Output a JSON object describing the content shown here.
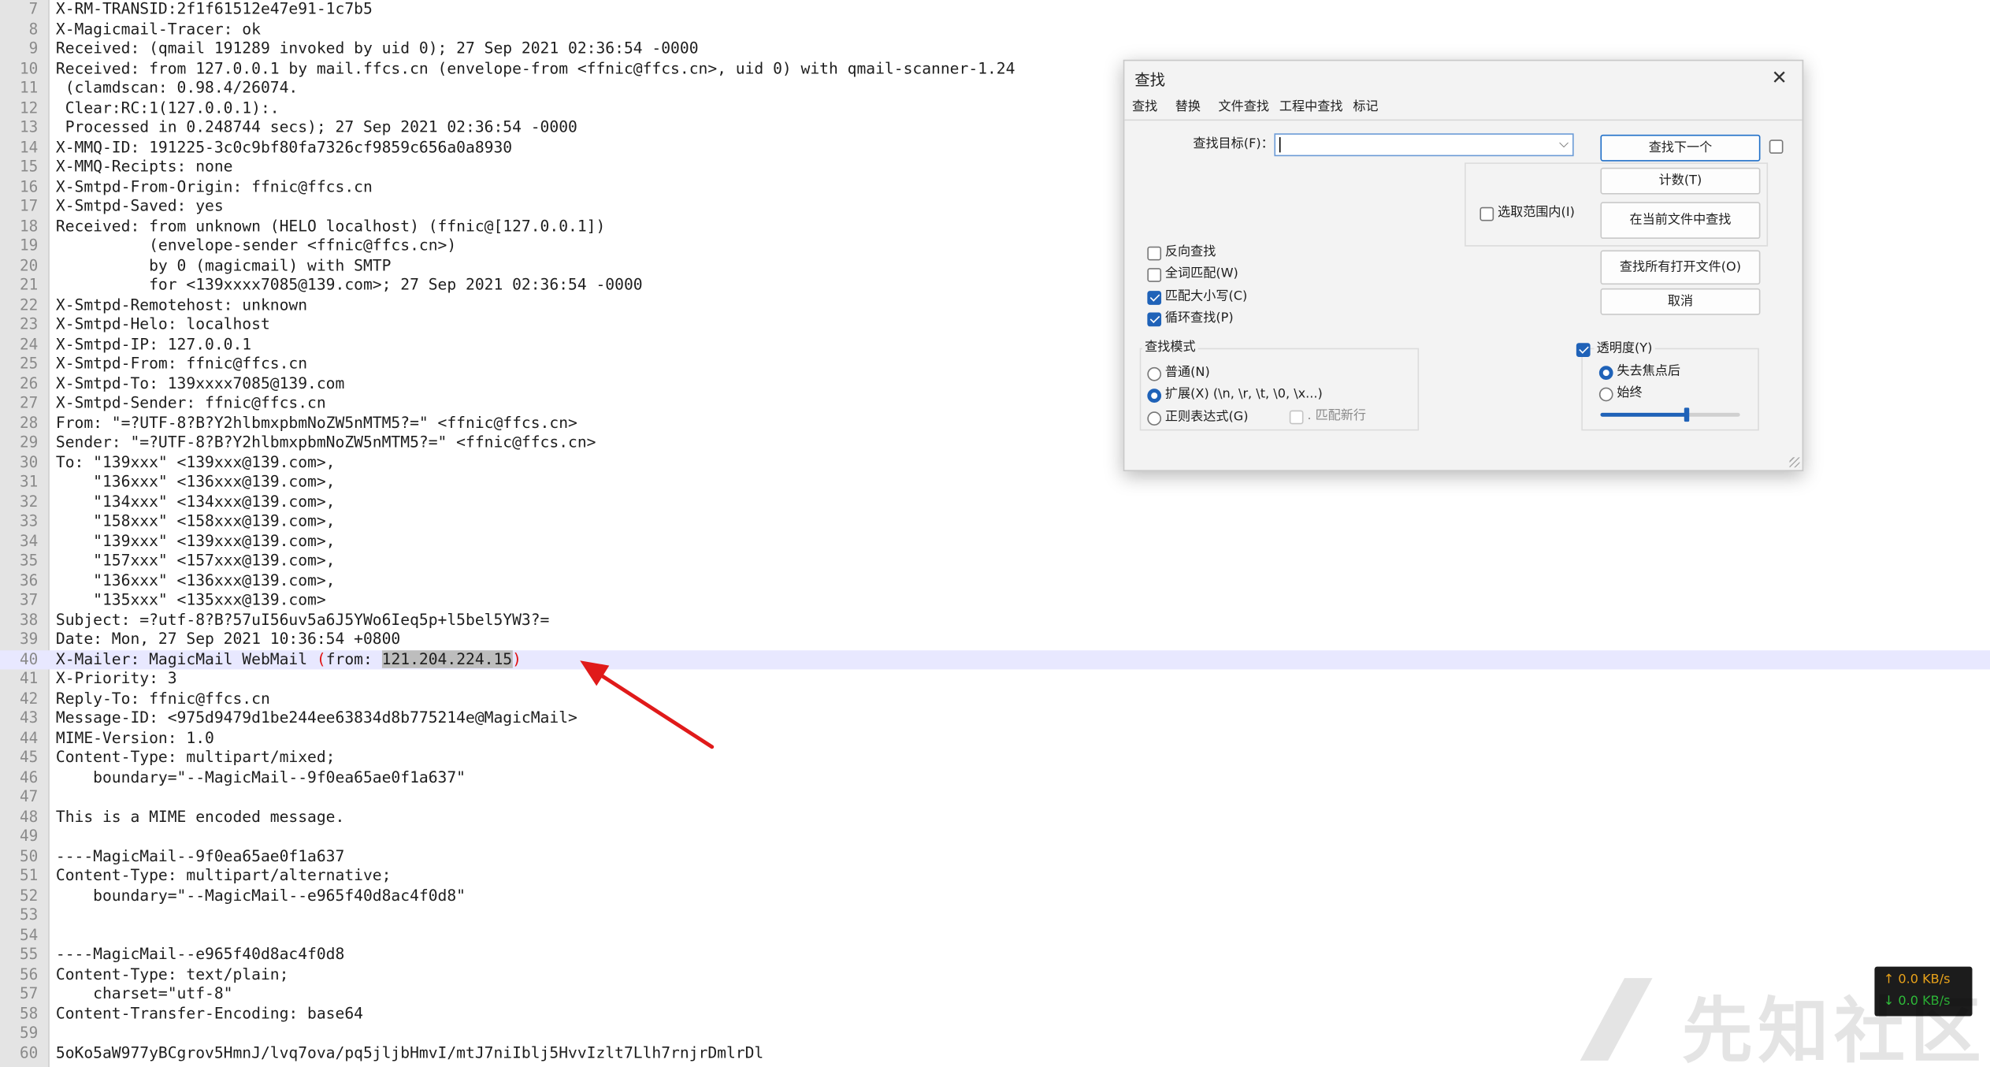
{
  "editor": {
    "lines": [
      {
        "n": "7",
        "t": "X-RM-TRANSID:2f1f61512e47e91-1c7b5"
      },
      {
        "n": "8",
        "t": "X-Magicmail-Tracer: ok"
      },
      {
        "n": "9",
        "t": "Received: (qmail 191289 invoked by uid 0); 27 Sep 2021 02:36:54 -0000"
      },
      {
        "n": "10",
        "t": "Received: from 127.0.0.1 by mail.ffcs.cn (envelope-from <ffnic@ffcs.cn>, uid 0) with qmail-scanner-1.24"
      },
      {
        "n": "11",
        "t": " (clamdscan: 0.98.4/26074."
      },
      {
        "n": "12",
        "t": " Clear:RC:1(127.0.0.1):."
      },
      {
        "n": "13",
        "t": " Processed in 0.248744 secs); 27 Sep 2021 02:36:54 -0000"
      },
      {
        "n": "14",
        "t": "X-MMQ-ID: 191225-3c0c9bf80fa7326cf9859c656a0a8930"
      },
      {
        "n": "15",
        "t": "X-MMQ-Recipts: none"
      },
      {
        "n": "16",
        "t": "X-Smtpd-From-Origin: ffnic@ffcs.cn"
      },
      {
        "n": "17",
        "t": "X-Smtpd-Saved: yes"
      },
      {
        "n": "18",
        "t": "Received: from unknown (HELO localhost) (ffnic@[127.0.0.1])"
      },
      {
        "n": "19",
        "t": "          (envelope-sender <ffnic@ffcs.cn>)"
      },
      {
        "n": "20",
        "t": "          by 0 (magicmail) with SMTP"
      },
      {
        "n": "21",
        "t": "          for <139xxxx7085@139.com>; 27 Sep 2021 02:36:54 -0000"
      },
      {
        "n": "22",
        "t": "X-Smtpd-Remotehost: unknown"
      },
      {
        "n": "23",
        "t": "X-Smtpd-Helo: localhost"
      },
      {
        "n": "24",
        "t": "X-Smtpd-IP: 127.0.0.1"
      },
      {
        "n": "25",
        "t": "X-Smtpd-From: ffnic@ffcs.cn"
      },
      {
        "n": "26",
        "t": "X-Smtpd-To: 139xxxx7085@139.com"
      },
      {
        "n": "27",
        "t": "X-Smtpd-Sender: ffnic@ffcs.cn"
      },
      {
        "n": "28",
        "t": "From: \"=?UTF-8?B?Y2hlbmxpbmNoZW5nMTM5?=\" <ffnic@ffcs.cn>"
      },
      {
        "n": "29",
        "t": "Sender: \"=?UTF-8?B?Y2hlbmxpbmNoZW5nMTM5?=\" <ffnic@ffcs.cn>"
      },
      {
        "n": "30",
        "t": "To: \"139xxx\" <139xxx@139.com>,"
      },
      {
        "n": "31",
        "t": "    \"136xxx\" <136xxx@139.com>,"
      },
      {
        "n": "32",
        "t": "    \"134xxx\" <134xxx@139.com>,"
      },
      {
        "n": "33",
        "t": "    \"158xxx\" <158xxx@139.com>,"
      },
      {
        "n": "34",
        "t": "    \"139xxx\" <139xxx@139.com>,"
      },
      {
        "n": "35",
        "t": "    \"157xxx\" <157xxx@139.com>,"
      },
      {
        "n": "36",
        "t": "    \"136xxx\" <136xxx@139.com>,"
      },
      {
        "n": "37",
        "t": "    \"135xxx\" <135xxx@139.com>"
      },
      {
        "n": "38",
        "t": "Subject: =?utf-8?B?57uI56uv5a6J5YWo6Ieq5p+l5bel5YW3?="
      },
      {
        "n": "39",
        "t": "Date: Mon, 27 Sep 2021 10:36:54 +0800"
      },
      {
        "n": "40",
        "t": "",
        "special": true
      },
      {
        "n": "41",
        "t": "X-Priority: 3"
      },
      {
        "n": "42",
        "t": "Reply-To: ffnic@ffcs.cn"
      },
      {
        "n": "43",
        "t": "Message-ID: <975d9479d1be244ee63834d8b775214e@MagicMail>"
      },
      {
        "n": "44",
        "t": "MIME-Version: 1.0"
      },
      {
        "n": "45",
        "t": "Content-Type: multipart/mixed;"
      },
      {
        "n": "46",
        "t": "    boundary=\"--MagicMail--9f0ea65ae0f1a637\""
      },
      {
        "n": "47",
        "t": ""
      },
      {
        "n": "48",
        "t": "This is a MIME encoded message."
      },
      {
        "n": "49",
        "t": ""
      },
      {
        "n": "50",
        "t": "----MagicMail--9f0ea65ae0f1a637"
      },
      {
        "n": "51",
        "t": "Content-Type: multipart/alternative;"
      },
      {
        "n": "52",
        "t": "    boundary=\"--MagicMail--e965f40d8ac4f0d8\""
      },
      {
        "n": "53",
        "t": ""
      },
      {
        "n": "54",
        "t": ""
      },
      {
        "n": "55",
        "t": "----MagicMail--e965f40d8ac4f0d8"
      },
      {
        "n": "56",
        "t": "Content-Type: text/plain;"
      },
      {
        "n": "57",
        "t": "    charset=\"utf-8\""
      },
      {
        "n": "58",
        "t": "Content-Transfer-Encoding: base64"
      },
      {
        "n": "59",
        "t": ""
      },
      {
        "n": "60",
        "t": "5oKo5aW977yBCgrov5HmnJ/lvq7ova/pq5jljbHmvI/mtJ7niIblj5HvvIzlt7Llh7rnjrDmlrDl"
      }
    ],
    "line40": {
      "prefix": "X-Mailer: MagicMail WebMail ",
      "open": "(",
      "from": "from: ",
      "ip": "121.204.224.15",
      "close": ")"
    },
    "highlight_line": "40"
  },
  "dialog": {
    "title": "查找",
    "close_label": "✕",
    "tabs": [
      "查找",
      "替换",
      "文件查找",
      "工程中查找",
      "标记"
    ],
    "active_tab": "查找",
    "search_label": "查找目标(F)：",
    "search_value": "",
    "find_next": "查找下一个",
    "count": "计数(T)",
    "find_in_current": "在当前文件中查找",
    "find_all_open": "查找所有打开文件(O)",
    "cancel": "取消",
    "in_selection": "选取范围内(I)",
    "options": [
      {
        "label": "反向查找",
        "checked": false
      },
      {
        "label": "全词匹配(W)",
        "checked": false
      },
      {
        "label": "匹配大小写(C)",
        "checked": true
      },
      {
        "label": "循环查找(P)",
        "checked": true
      }
    ],
    "search_mode_title": "查找模式",
    "modes": [
      {
        "label": "普通(N)",
        "selected": false
      },
      {
        "label": "扩展(X) (\\n, \\r, \\t, \\0, \\x...)",
        "selected": true
      },
      {
        "label": "正则表达式(G)",
        "selected": false
      }
    ],
    "match_newline": ". 匹配新行",
    "transparency": "透明度(Y)",
    "transparency_checked": true,
    "trans_modes": [
      {
        "label": "失去焦点后",
        "selected": true
      },
      {
        "label": "始终",
        "selected": false
      }
    ],
    "transparency_level": 0.62
  },
  "speed": {
    "up": "↑ 0.0 KB/s",
    "down": "↓ 0.0 KB/s"
  },
  "watermark": "先知社区",
  "colors": {
    "accent": "#1f62b8",
    "highlight_line": "#e8e8ff",
    "arrow": "#e01a1a",
    "selection": "#bdbdbd"
  }
}
